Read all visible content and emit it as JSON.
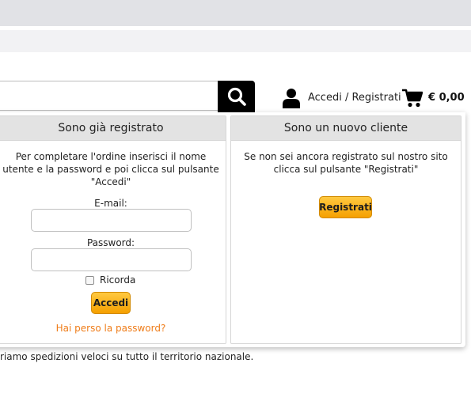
{
  "header": {
    "login_label": "Accedi / Registrati",
    "cart_total": "€ 0,00",
    "search_icon": "search-icon",
    "user_icon": "user-icon",
    "cart_icon": "shopping-cart-icon"
  },
  "login_panel": {
    "title": "Sono già registrato",
    "description": "Per completare l'ordine inserisci il nome utente e la password e poi clicca sul pulsante \"Accedi\"",
    "email_label": "E-mail:",
    "email_value": "",
    "password_label": "Password:",
    "password_value": "",
    "remember_label": "Ricorda",
    "submit_label": "Accedi",
    "forgot_label": "Hai perso la password?"
  },
  "register_panel": {
    "title": "Sono un nuovo cliente",
    "description": "Se non sei ancora registrato sul nostro sito clicca sul pulsante \"Registrati\"",
    "button_label": "Registrati"
  },
  "footer": {
    "text": "riamo spedizioni veloci su tutto il territorio nazionale."
  },
  "colors": {
    "accent_orange": "#f5a000",
    "link_orange": "#ef7d1a",
    "panel_header": "#e3e3e3"
  }
}
